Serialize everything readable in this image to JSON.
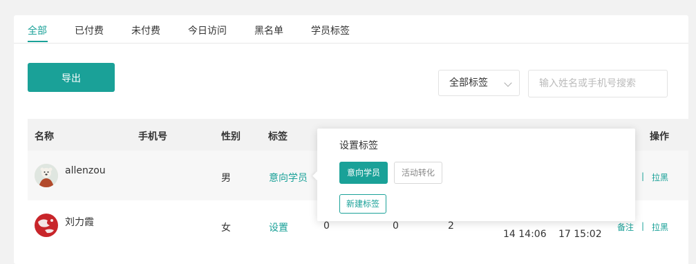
{
  "tabs": [
    {
      "label": "全部",
      "active": true
    },
    {
      "label": "已付费"
    },
    {
      "label": "未付费"
    },
    {
      "label": "今日访问"
    },
    {
      "label": "黑名单"
    },
    {
      "label": "学员标签"
    }
  ],
  "toolbar": {
    "export_label": "导出",
    "tag_filter_value": "全部标签",
    "search_placeholder": "输入姓名或手机号搜索"
  },
  "table": {
    "headers": {
      "name": "名称",
      "phone": "手机号",
      "gender": "性别",
      "tags": "标签",
      "actions": "操作"
    },
    "rows": [
      {
        "name": "allenzou",
        "gender": "男",
        "tag": "意向学员",
        "action_pull_black": "拉黑"
      },
      {
        "name": "刘力霞",
        "gender": "女",
        "tag": "设置",
        "col_a": "0",
        "col_b": "0",
        "col_c": "2",
        "time_1": "14 14:06",
        "time_2": "17 15:02",
        "action_note": "备注",
        "action_pull_black": "拉黑"
      }
    ],
    "action_separator": "|"
  },
  "popover": {
    "title": "设置标签",
    "tags": [
      {
        "label": "意向学员",
        "selected": true
      },
      {
        "label": "活动转化",
        "selected": false
      }
    ],
    "new_tag_label": "新建标签"
  },
  "colors": {
    "accent": "#1aa198",
    "background": "#f2f2f2"
  }
}
